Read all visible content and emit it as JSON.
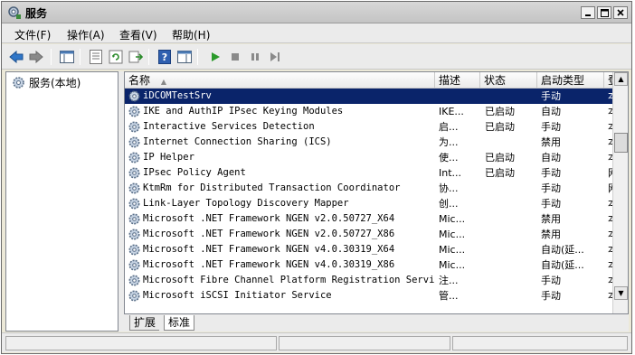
{
  "window": {
    "title": "服务"
  },
  "menu": [
    "文件(F)",
    "操作(A)",
    "查看(V)",
    "帮助(H)"
  ],
  "tree": {
    "root": "服务(本地)"
  },
  "columns": {
    "name": "名称",
    "desc": "描述",
    "status": "状态",
    "startup": "启动类型",
    "logon": "登"
  },
  "rows": [
    {
      "name": "iDCOMTestSrv",
      "desc": "",
      "status": "",
      "startup": "手动",
      "logon": "本"
    },
    {
      "name": "IKE and AuthIP IPsec Keying Modules",
      "desc": "IKE...",
      "status": "已启动",
      "startup": "自动",
      "logon": "本"
    },
    {
      "name": "Interactive Services Detection",
      "desc": "启...",
      "status": "已启动",
      "startup": "手动",
      "logon": "本"
    },
    {
      "name": "Internet Connection Sharing (ICS)",
      "desc": "为...",
      "status": "",
      "startup": "禁用",
      "logon": "本"
    },
    {
      "name": "IP Helper",
      "desc": "使...",
      "status": "已启动",
      "startup": "自动",
      "logon": "本"
    },
    {
      "name": "IPsec Policy Agent",
      "desc": "Int...",
      "status": "已启动",
      "startup": "手动",
      "logon": "网"
    },
    {
      "name": "KtmRm for Distributed Transaction Coordinator",
      "desc": "协...",
      "status": "",
      "startup": "手动",
      "logon": "网"
    },
    {
      "name": "Link-Layer Topology Discovery Mapper",
      "desc": "创...",
      "status": "",
      "startup": "手动",
      "logon": "本"
    },
    {
      "name": "Microsoft .NET Framework NGEN v2.0.50727_X64",
      "desc": "Mic...",
      "status": "",
      "startup": "禁用",
      "logon": "本"
    },
    {
      "name": "Microsoft .NET Framework NGEN v2.0.50727_X86",
      "desc": "Mic...",
      "status": "",
      "startup": "禁用",
      "logon": "本"
    },
    {
      "name": "Microsoft .NET Framework NGEN v4.0.30319_X64",
      "desc": "Mic...",
      "status": "",
      "startup": "自动(延...",
      "logon": "本"
    },
    {
      "name": "Microsoft .NET Framework NGEN v4.0.30319_X86",
      "desc": "Mic...",
      "status": "",
      "startup": "自动(延...",
      "logon": "本"
    },
    {
      "name": "Microsoft Fibre Channel Platform Registration Service",
      "desc": "注...",
      "status": "",
      "startup": "手动",
      "logon": "本"
    },
    {
      "name": "Microsoft iSCSI Initiator Service",
      "desc": "管...",
      "status": "",
      "startup": "手动",
      "logon": "本"
    }
  ],
  "tabs": [
    "扩展",
    "标准"
  ],
  "selected_row": 0
}
